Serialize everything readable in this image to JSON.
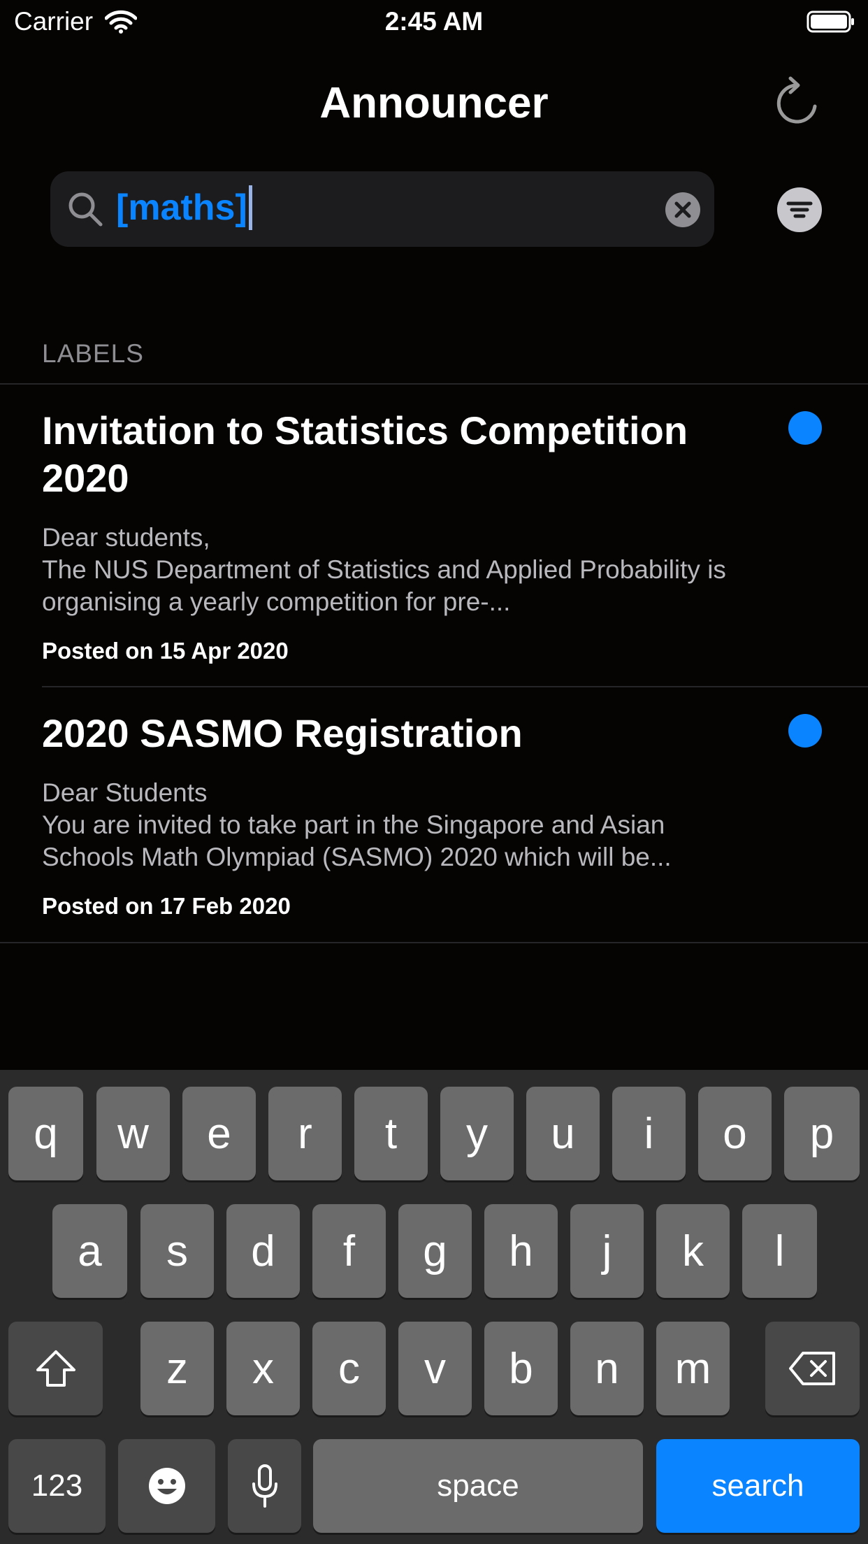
{
  "status_bar": {
    "carrier": "Carrier",
    "time": "2:45 AM"
  },
  "nav": {
    "title": "Announcer",
    "refresh_icon": "refresh-icon"
  },
  "search": {
    "value": "[maths]",
    "search_icon": "magnifier-icon",
    "clear_icon": "clear-icon",
    "filter_icon": "filter-icon"
  },
  "section": {
    "header": "LABELS"
  },
  "announcements": [
    {
      "title": "Invitation to Statistics Competition 2020",
      "body": "Dear students,\nThe NUS Department of Statistics and Applied Probability is organising a yearly competition for pre-...",
      "date": "Posted on 15 Apr 2020",
      "unread": true
    },
    {
      "title": "2020 SASMO Registration",
      "body": "Dear Students\nYou are invited to take part in the Singapore and Asian Schools Math Olympiad (SASMO) 2020 which will be...",
      "date": "Posted on 17 Feb 2020",
      "unread": true
    }
  ],
  "keyboard": {
    "row1": [
      "q",
      "w",
      "e",
      "r",
      "t",
      "y",
      "u",
      "i",
      "o",
      "p"
    ],
    "row2": [
      "a",
      "s",
      "d",
      "f",
      "g",
      "h",
      "j",
      "k",
      "l"
    ],
    "row3": [
      "z",
      "x",
      "c",
      "v",
      "b",
      "n",
      "m"
    ],
    "numbers_label": "123",
    "space_label": "space",
    "search_label": "search"
  },
  "colors": {
    "accent": "#0a84ff",
    "background": "#050402",
    "secondary_text": "#8e8e93"
  }
}
